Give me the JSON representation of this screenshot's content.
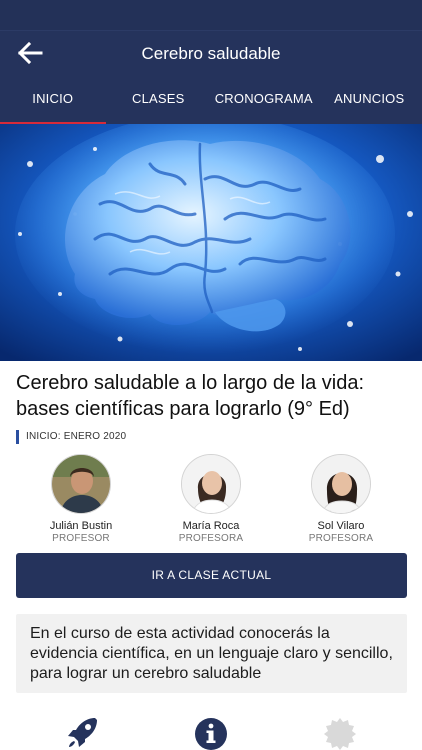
{
  "header": {
    "title": "Cerebro saludable",
    "back_icon": "arrow-left-icon"
  },
  "tabs": [
    {
      "label": "INICIO",
      "active": true
    },
    {
      "label": "CLASES",
      "active": false
    },
    {
      "label": "CRONOGRAMA",
      "active": false
    },
    {
      "label": "ANUNCIOS",
      "active": false
    }
  ],
  "hero": {
    "icon": "glowing-brain-illustration"
  },
  "course": {
    "title": "Cerebro saludable a lo largo de la vida: bases científicas para lograrlo (9° Ed)",
    "start": "INICIO: ENERO 2020"
  },
  "teachers": [
    {
      "name": "Julián Bustin",
      "role": "PROFESOR"
    },
    {
      "name": "María Roca",
      "role": "PROFESORA"
    },
    {
      "name": "Sol Vilaro",
      "role": "PROFESORA"
    }
  ],
  "cta": {
    "label": "IR A CLASE ACTUAL"
  },
  "description": "En el curso de esta actividad conocerás la evidencia científica, en un lenguaje claro y sencillo, para lograr un cerebro saludable",
  "bottom_icons": [
    "rocket-icon",
    "info-icon",
    "badge-icon"
  ],
  "colors": {
    "primary": "#25335c",
    "accent": "#d62b3a",
    "card": "#f1f1f1"
  }
}
